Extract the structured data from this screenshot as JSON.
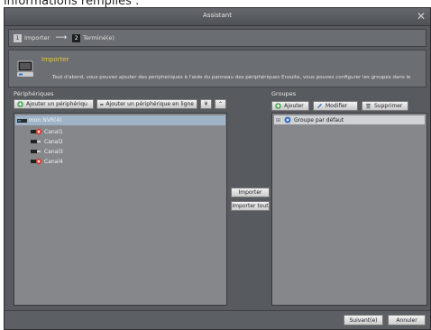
{
  "caption_text": "informations remplies :",
  "window": {
    "title": "Assistant",
    "close_glyph": "✕"
  },
  "steps": [
    {
      "number": "1",
      "label": "Importer"
    },
    {
      "number": "2",
      "label": "Terminé(e)"
    }
  ],
  "steps_arrow": "⟶",
  "banner": {
    "title": "Importer",
    "description": "Tout d'abord, vous pouvez ajouter des périphériques à l'aide du panneau des périphériques Ensuite, vous pouvez configurer les groupes dans le"
  },
  "devices": {
    "label": "Périphériques",
    "add_device": "Ajouter un périphériqu",
    "add_online": "Ajouter un périphérique en ligne",
    "expand_glyph": "¥",
    "collapse_glyph": "⌃",
    "tree": {
      "root": "mon NVR(4)",
      "channels": [
        "Canal1",
        "Canal2",
        "Canal3",
        "Canal4"
      ]
    }
  },
  "middle": {
    "import": "Importer",
    "import_all": "Importer tout"
  },
  "groups": {
    "label": "Groupes",
    "add": "Ajouter",
    "modify": "Modifier",
    "delete": "Supprimer",
    "default_group": "Groupe par défaut",
    "expand_glyph": "⊞"
  },
  "footer": {
    "next": "Suivant(e)",
    "cancel": "Annuler"
  },
  "colors": {
    "accent_title": "#e7c64a",
    "selected_row": "#9fb3c7",
    "window_bg": "#575a5e"
  }
}
